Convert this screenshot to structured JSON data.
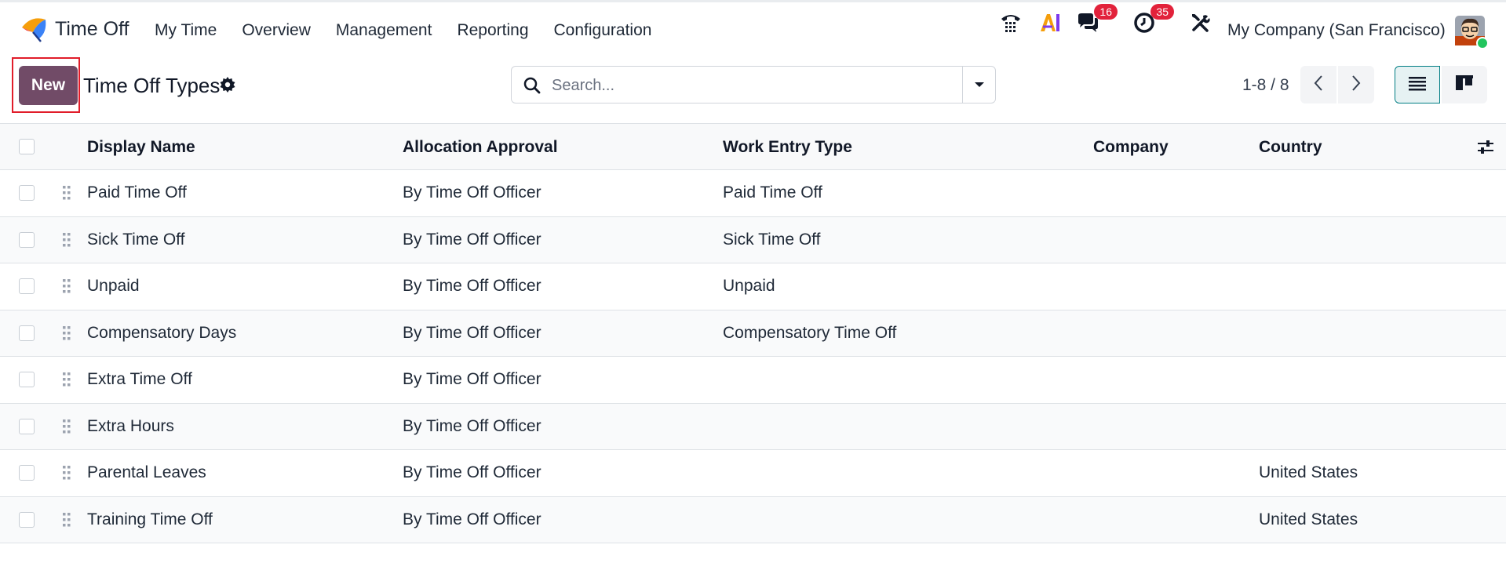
{
  "app": {
    "name": "Time Off"
  },
  "menu": [
    {
      "label": "My Time"
    },
    {
      "label": "Overview"
    },
    {
      "label": "Management"
    },
    {
      "label": "Reporting"
    },
    {
      "label": "Configuration"
    }
  ],
  "systray": {
    "messages_count": "16",
    "activities_count": "35",
    "company": "My Company (San Francisco)"
  },
  "control": {
    "new_label": "New",
    "title": "Time Off Types",
    "search_placeholder": "Search...",
    "pager": "1-8 / 8"
  },
  "table": {
    "headers": {
      "display_name": "Display Name",
      "allocation_approval": "Allocation Approval",
      "work_entry_type": "Work Entry Type",
      "company": "Company",
      "country": "Country"
    },
    "rows": [
      {
        "name": "Paid Time Off",
        "approval": "By Time Off Officer",
        "work_entry": "Paid Time Off",
        "company": "",
        "country": ""
      },
      {
        "name": "Sick Time Off",
        "approval": "By Time Off Officer",
        "work_entry": "Sick Time Off",
        "company": "",
        "country": ""
      },
      {
        "name": "Unpaid",
        "approval": "By Time Off Officer",
        "work_entry": "Unpaid",
        "company": "",
        "country": ""
      },
      {
        "name": "Compensatory Days",
        "approval": "By Time Off Officer",
        "work_entry": "Compensatory Time Off",
        "company": "",
        "country": ""
      },
      {
        "name": "Extra Time Off",
        "approval": "By Time Off Officer",
        "work_entry": "",
        "company": "",
        "country": ""
      },
      {
        "name": "Extra Hours",
        "approval": "By Time Off Officer",
        "work_entry": "",
        "company": "",
        "country": ""
      },
      {
        "name": "Parental Leaves",
        "approval": "By Time Off Officer",
        "work_entry": "",
        "company": "",
        "country": "United States"
      },
      {
        "name": "Training Time Off",
        "approval": "By Time Off Officer",
        "work_entry": "",
        "company": "",
        "country": "United States"
      }
    ]
  },
  "colors": {
    "primary": "#714b67",
    "badge": "#e2223b",
    "highlight": "#e11d2a"
  }
}
